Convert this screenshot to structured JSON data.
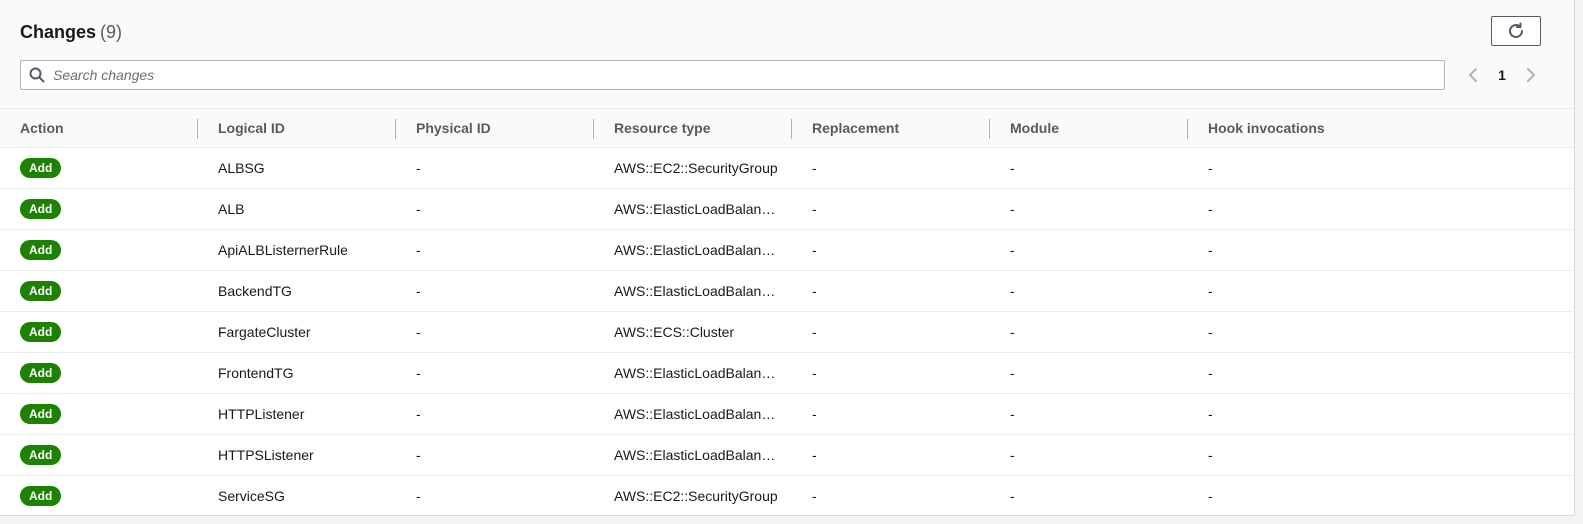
{
  "header": {
    "title": "Changes",
    "count": "(9)",
    "refresh_label": "Refresh"
  },
  "search": {
    "placeholder": "Search changes"
  },
  "pagination": {
    "current_page": "1"
  },
  "table": {
    "columns": [
      "Action",
      "Logical ID",
      "Physical ID",
      "Resource type",
      "Replacement",
      "Module",
      "Hook invocations"
    ],
    "rows": [
      {
        "action": "Add",
        "logical_id": "ALBSG",
        "physical_id": "-",
        "resource_type": "AWS::EC2::SecurityGroup",
        "replacement": "-",
        "module": "-",
        "hook_invocations": "-"
      },
      {
        "action": "Add",
        "logical_id": "ALB",
        "physical_id": "-",
        "resource_type": "AWS::ElasticLoadBalan…",
        "replacement": "-",
        "module": "-",
        "hook_invocations": "-"
      },
      {
        "action": "Add",
        "logical_id": "ApiALBListernerRule",
        "physical_id": "-",
        "resource_type": "AWS::ElasticLoadBalan…",
        "replacement": "-",
        "module": "-",
        "hook_invocations": "-"
      },
      {
        "action": "Add",
        "logical_id": "BackendTG",
        "physical_id": "-",
        "resource_type": "AWS::ElasticLoadBalan…",
        "replacement": "-",
        "module": "-",
        "hook_invocations": "-"
      },
      {
        "action": "Add",
        "logical_id": "FargateCluster",
        "physical_id": "-",
        "resource_type": "AWS::ECS::Cluster",
        "replacement": "-",
        "module": "-",
        "hook_invocations": "-"
      },
      {
        "action": "Add",
        "logical_id": "FrontendTG",
        "physical_id": "-",
        "resource_type": "AWS::ElasticLoadBalan…",
        "replacement": "-",
        "module": "-",
        "hook_invocations": "-"
      },
      {
        "action": "Add",
        "logical_id": "HTTPListener",
        "physical_id": "-",
        "resource_type": "AWS::ElasticLoadBalan…",
        "replacement": "-",
        "module": "-",
        "hook_invocations": "-"
      },
      {
        "action": "Add",
        "logical_id": "HTTPSListener",
        "physical_id": "-",
        "resource_type": "AWS::ElasticLoadBalan…",
        "replacement": "-",
        "module": "-",
        "hook_invocations": "-"
      },
      {
        "action": "Add",
        "logical_id": "ServiceSG",
        "physical_id": "-",
        "resource_type": "AWS::EC2::SecurityGroup",
        "replacement": "-",
        "module": "-",
        "hook_invocations": "-"
      }
    ]
  },
  "icons": {
    "refresh": "refresh-icon",
    "search": "search-icon",
    "prev": "chevron-left-icon",
    "next": "chevron-right-icon"
  },
  "colors": {
    "badge_add": "#1d8102",
    "border": "#aab7b8",
    "header_bg": "#fafafa"
  }
}
